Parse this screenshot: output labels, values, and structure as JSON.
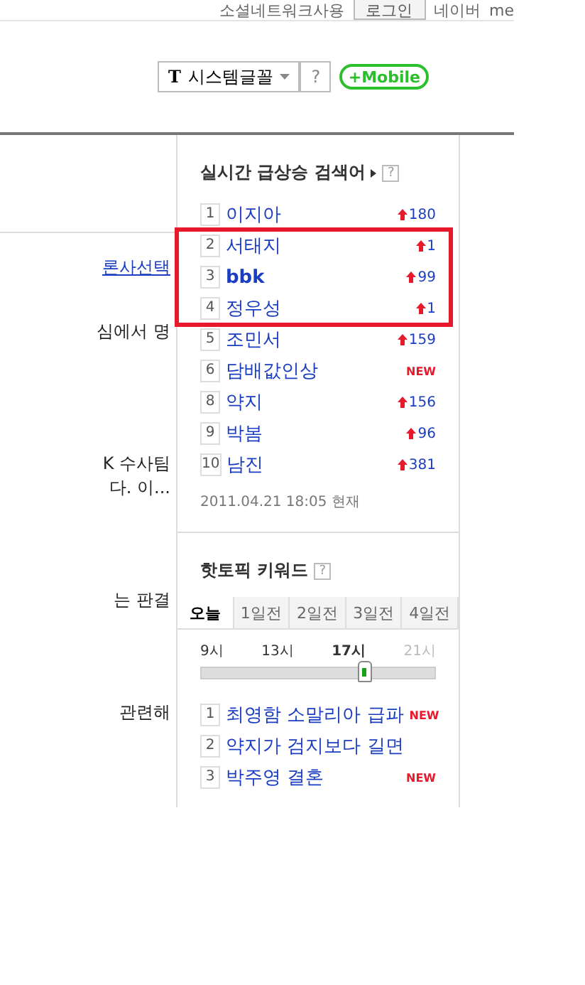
{
  "top_bar": {
    "links": [
      "소셜네트워크사용"
    ],
    "login_button": "로그인",
    "service_links": [
      "네이버",
      "me"
    ]
  },
  "toolbar": {
    "font_select": {
      "icon_text": "T",
      "value": "시스템글꼴"
    },
    "help_button": "?",
    "mobile_button": "+Mobile"
  },
  "article_snippets": [
    {
      "kind": "link",
      "text": "론사선택"
    },
    {
      "kind": "text",
      "text": "심에서 명"
    },
    {
      "kind": "text",
      "text": "K 수사팀\n다. 이..."
    },
    {
      "kind": "text",
      "text": "는 판결"
    },
    {
      "kind": "text",
      "text": "관련해"
    }
  ],
  "realtime": {
    "title": "실시간 급상승 검색어",
    "help": "?",
    "items": [
      {
        "rank": "1",
        "keyword": "이지아",
        "change": "180",
        "kind": "up",
        "bold": false
      },
      {
        "rank": "2",
        "keyword": "서태지",
        "change": "1",
        "kind": "up",
        "bold": false
      },
      {
        "rank": "3",
        "keyword": "bbk",
        "change": "99",
        "kind": "up",
        "bold": true
      },
      {
        "rank": "4",
        "keyword": "정우성",
        "change": "1",
        "kind": "up",
        "bold": false
      },
      {
        "rank": "5",
        "keyword": "조민서",
        "change": "159",
        "kind": "up",
        "bold": false
      },
      {
        "rank": "6",
        "keyword": "담배값인상",
        "change": "NEW",
        "kind": "new",
        "bold": false
      },
      {
        "rank": "8",
        "keyword": "약지",
        "change": "156",
        "kind": "up",
        "bold": false
      },
      {
        "rank": "9",
        "keyword": "박봄",
        "change": "96",
        "kind": "up",
        "bold": false
      },
      {
        "rank": "10",
        "keyword": "남진",
        "change": "381",
        "kind": "up",
        "bold": false
      }
    ],
    "timestamp": "2011.04.21 18:05 현재"
  },
  "annotation": {
    "kind": "rectangle",
    "color": "#e8192c"
  },
  "hot_topics": {
    "title": "핫토픽 키워드",
    "help": "?",
    "tabs": [
      {
        "label": "오늘",
        "selected": true
      },
      {
        "label": "1일전",
        "selected": false
      },
      {
        "label": "2일전",
        "selected": false
      },
      {
        "label": "3일전",
        "selected": false
      },
      {
        "label": "4일전",
        "selected": false
      }
    ],
    "times": [
      {
        "label": "9시",
        "selected": false,
        "disabled": false
      },
      {
        "label": "13시",
        "selected": false,
        "disabled": false
      },
      {
        "label": "17시",
        "selected": true,
        "disabled": false
      },
      {
        "label": "21시",
        "selected": false,
        "disabled": true
      }
    ],
    "slider": {
      "level": 0.7
    },
    "items": [
      {
        "rank": "1",
        "keyword": "최영함 소말리아 급파",
        "badge": "NEW"
      },
      {
        "rank": "2",
        "keyword": "약지가 검지보다 길면"
      },
      {
        "rank": "3",
        "keyword": "박주영 결혼",
        "badge": "NEW"
      }
    ]
  }
}
